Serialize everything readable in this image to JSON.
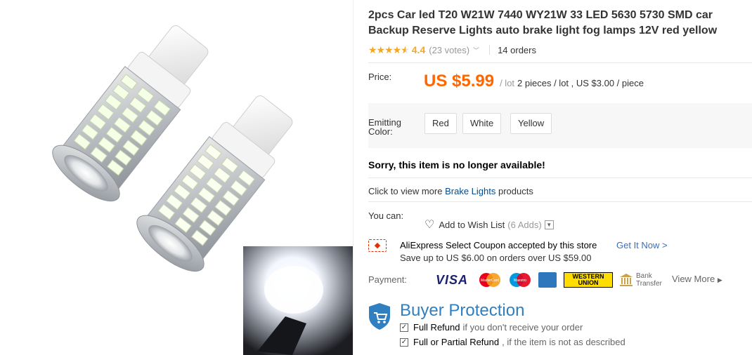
{
  "product": {
    "title": "2pcs Car led T20 W21W 7440 WY21W 33 LED 5630 5730 SMD car Backup Reserve Lights auto brake light fog lamps 12V red yellow",
    "rating": "4.4",
    "votes": "(23 votes)",
    "orders": "14 orders"
  },
  "price": {
    "label": "Price:",
    "amount": "US $5.99",
    "per": "/ lot",
    "detail": "2 pieces / lot , US $3.00 / piece"
  },
  "options": {
    "label_line1": "Emitting",
    "label_line2": "Color:",
    "colors": [
      "Red",
      "White",
      "Yellow"
    ]
  },
  "availability": {
    "message": "Sorry, this item is no longer available!",
    "click_prefix": "Click to view more",
    "category_link": "Brake Lights",
    "click_suffix": "products"
  },
  "actions": {
    "you_can": "You can:",
    "wishlist": "Add to Wish List",
    "adds": "(6 Adds)"
  },
  "coupon": {
    "title": "AliExpress Select Coupon accepted by this store",
    "subtitle": "Save up to US $6.00 on orders over US $59.00",
    "get_it": "Get It Now >"
  },
  "payment": {
    "label": "Payment:",
    "visa": "VISA",
    "mastercard": "MasterCard",
    "maestro": "Maestro",
    "western_union_1": "WESTERN",
    "western_union_2": "UNION",
    "bank_1": "Bank",
    "bank_2": "Transfer",
    "view_more": "View More"
  },
  "protection": {
    "title": "Buyer Protection",
    "item1_strong": "Full Refund",
    "item1_note": "if you don't receive your order",
    "item2_strong": "Full or Partial Refund",
    "item2_note": ", if the item is not as described"
  },
  "colors": {
    "price": "#ff6600",
    "star": "#f5a623",
    "link": "#034b8c",
    "buyer_protection": "#2f7fc1"
  }
}
